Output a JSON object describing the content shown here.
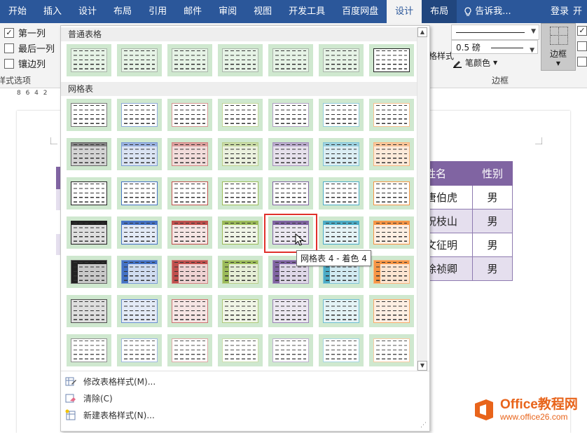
{
  "ribbon": {
    "tabs": [
      {
        "label": "开始"
      },
      {
        "label": "插入"
      },
      {
        "label": "设计"
      },
      {
        "label": "布局"
      },
      {
        "label": "引用"
      },
      {
        "label": "邮件"
      },
      {
        "label": "审阅"
      },
      {
        "label": "视图"
      },
      {
        "label": "开发工具"
      },
      {
        "label": "百度网盘"
      },
      {
        "label": "设计"
      },
      {
        "label": "布局"
      }
    ],
    "tell_me": "告诉我...",
    "login": "登录",
    "last_tab": "开",
    "options": {
      "first_column": "第一列",
      "last_column": "最后一列",
      "banded_columns": "镶边列",
      "group_label": "样式选项",
      "first_column_checked": "✓"
    },
    "table_styles_cut": "格样式",
    "borders": {
      "line_weight": "0.5 磅",
      "pen_color": "笔颜色",
      "border_button": "边框",
      "group_label": "边框"
    }
  },
  "ruler": {
    "text": "8 6 4 2"
  },
  "gallery": {
    "plain_section": "普通表格",
    "grid_section": "网格表",
    "tooltip": "网格表 4 - 着色 4",
    "menu": {
      "modify": "修改表格样式(M)...",
      "clear": "清除(C)",
      "new": "新建表格样式(N)..."
    },
    "accent_colors": [
      "#222222",
      "#4472c4",
      "#c0504d",
      "#9bbb59",
      "#8064a2",
      "#4bacc6",
      "#f79646"
    ],
    "swatch_bg": "#cfe8cf"
  },
  "document": {
    "table": {
      "headers": [
        "姓名",
        "性别"
      ],
      "rows": [
        [
          "唐伯虎",
          "男"
        ],
        [
          "祝枝山",
          "男"
        ],
        [
          "文征明",
          "男"
        ],
        [
          "徐祯卿",
          "男"
        ]
      ]
    }
  },
  "watermark": {
    "brand": "Office教程网",
    "url": "www.office26.com"
  }
}
